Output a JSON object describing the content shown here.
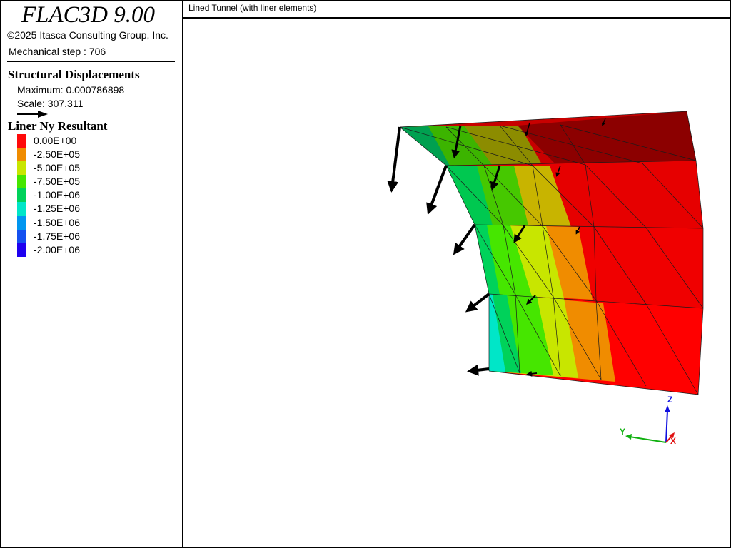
{
  "app": {
    "title": "FLAC3D 9.00",
    "copyright": "©2025 Itasca Consulting Group, Inc."
  },
  "state": {
    "step_text": "Mechanical step : 706"
  },
  "displacements": {
    "title": "Structural Displacements",
    "maximum": "Maximum: 0.000786898",
    "scale": "Scale: 307.311"
  },
  "contour": {
    "title": "Liner Ny Resultant",
    "items": [
      {
        "label": " 0.00E+00",
        "color": "#ff0a0a"
      },
      {
        "label": "-2.50E+05",
        "color": "#f08c00"
      },
      {
        "label": "-5.00E+05",
        "color": "#c8e600"
      },
      {
        "label": "-7.50E+05",
        "color": "#46e600"
      },
      {
        "label": "-1.00E+06",
        "color": "#00d25a"
      },
      {
        "label": "-1.25E+06",
        "color": "#00e6c8"
      },
      {
        "label": "-1.50E+06",
        "color": "#0096f0"
      },
      {
        "label": "-1.75E+06",
        "color": "#1450f0"
      },
      {
        "label": "-2.00E+06",
        "color": "#1e00f0"
      }
    ]
  },
  "plot": {
    "title": "Lined Tunnel (with liner elements)",
    "axes": {
      "x": "X",
      "y": "Y",
      "z": "Z"
    },
    "axis_colors": {
      "x": "#e01010",
      "y": "#10b010",
      "z": "#1010e0"
    }
  }
}
